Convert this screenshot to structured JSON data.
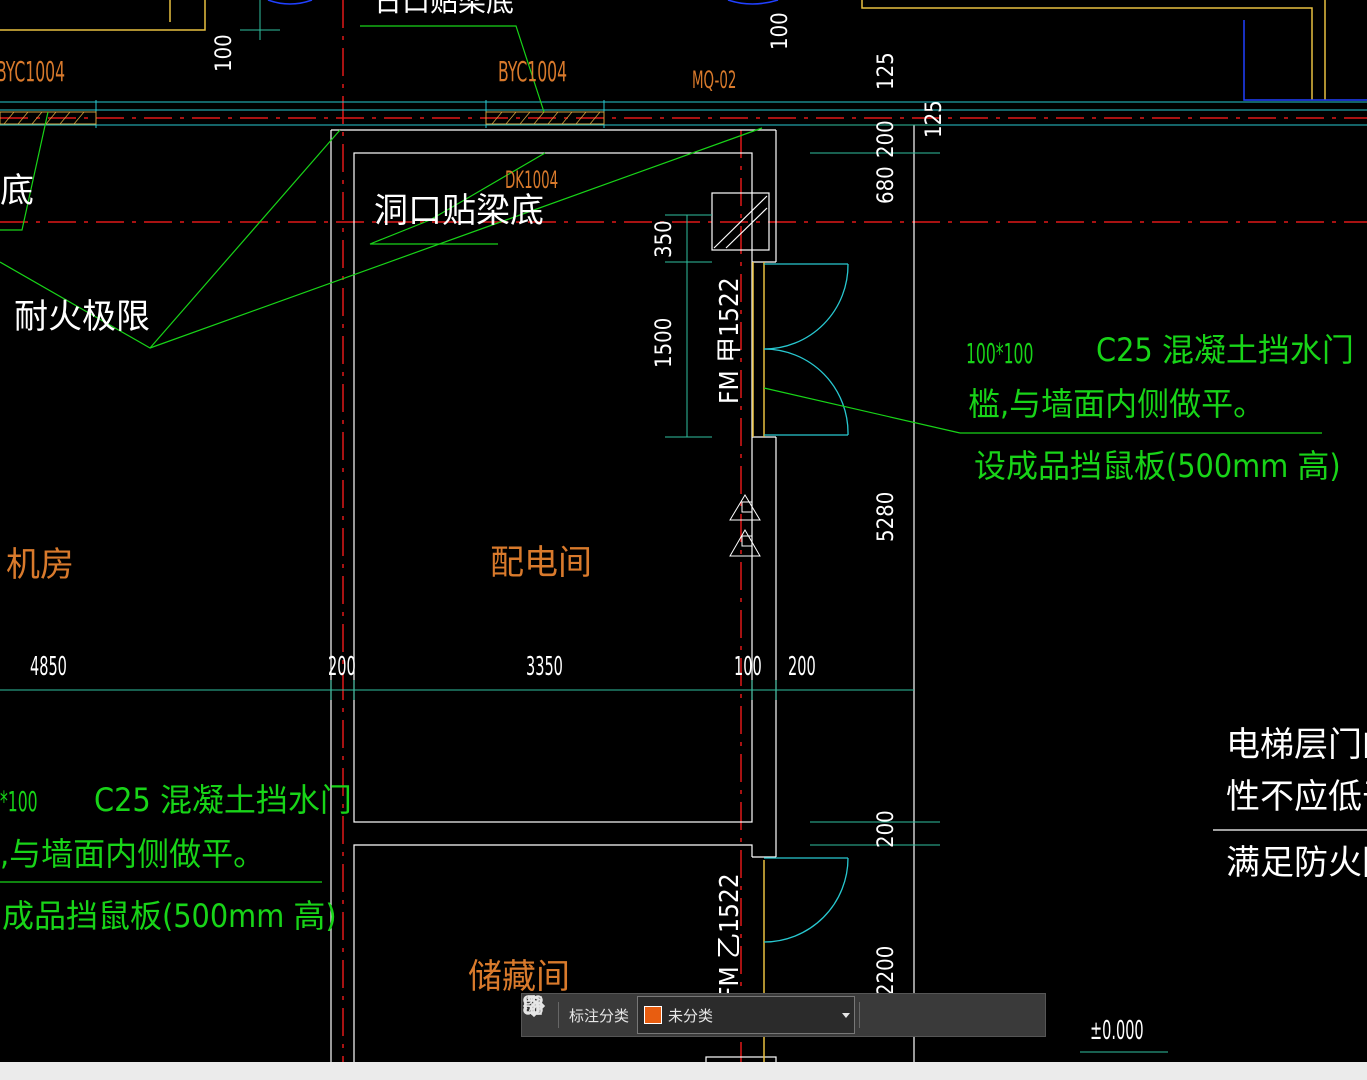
{
  "drawing": {
    "labels": {
      "top_clipped": "日口贴梁底",
      "byc_left": "BYC1004",
      "byc_center": "BYC1004",
      "mq": "MQ-02",
      "dk": "DK1004",
      "opening_label": "洞口贴梁底",
      "left_di": "底",
      "fire_limit": "耐火极限",
      "room_left": "机房",
      "room_power": "配电间",
      "room_storage": "储藏间",
      "door_fm_jia": "FM 甲1522",
      "door_fm_yi": "FM 乙1522",
      "note_right_1a": "100*100",
      "note_right_1b": "C25 混凝土挡水门",
      "note_right_2": "槛,与墙面内侧做平。",
      "note_right_3": "设成品挡鼠板(500mm 高)",
      "note_left_1a": "*100",
      "note_left_1b": "C25 混凝土挡水门",
      "note_left_2": ",与墙面内侧做平。",
      "note_left_3": "成品挡鼠板(500mm 高)",
      "elevator_1": "电梯层门的",
      "elevator_2": "性不应低于",
      "elevator_3": "满足防火防",
      "level": "±0.000"
    },
    "dimensions": {
      "d4850": "4850",
      "d200a": "200",
      "d3350": "3350",
      "d100": "100",
      "d200b": "200",
      "v100a": "100",
      "v100b": "100",
      "v125a": "125",
      "v125b": "125",
      "v200a": "200",
      "v680": "680",
      "v350": "350",
      "v1500": "1500",
      "v5280": "5280",
      "v200b": "200",
      "v2200": "2200"
    }
  },
  "toolbar": {
    "label": "标注分类",
    "category_value": "未分类",
    "category_color": "#e85d10",
    "icons": [
      "grid-icon",
      "edit-icon",
      "move-icon",
      "copy-icon",
      "paste-icon"
    ]
  }
}
